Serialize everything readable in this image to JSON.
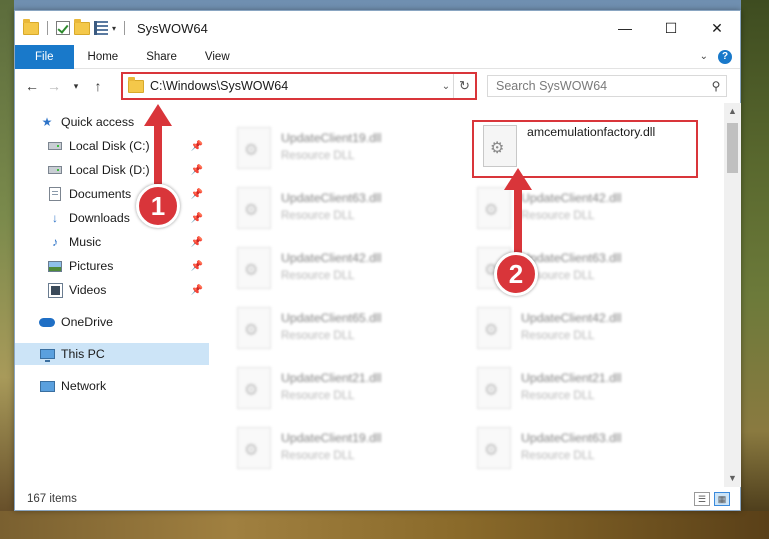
{
  "window": {
    "title": "SysWOW64",
    "controls": {
      "minimize": "—",
      "maximize": "☐",
      "close": "✕"
    }
  },
  "ribbon": {
    "tabs": [
      "File",
      "Home",
      "Share",
      "View"
    ]
  },
  "navbar": {
    "address": "C:\\Windows\\SysWOW64",
    "search_placeholder": "Search SysWOW64"
  },
  "sidebar": {
    "items": [
      {
        "label": "Quick access",
        "icon": "star-icon",
        "pinned": false
      },
      {
        "label": "Local Disk (C:)",
        "icon": "drive-icon",
        "pinned": true
      },
      {
        "label": "Local Disk (D:)",
        "icon": "drive-icon",
        "pinned": true
      },
      {
        "label": "Documents",
        "icon": "documents-icon",
        "pinned": true
      },
      {
        "label": "Downloads",
        "icon": "downloads-icon",
        "pinned": true
      },
      {
        "label": "Music",
        "icon": "music-icon",
        "pinned": true
      },
      {
        "label": "Pictures",
        "icon": "pictures-icon",
        "pinned": true
      },
      {
        "label": "Videos",
        "icon": "videos-icon",
        "pinned": true
      },
      {
        "label": "OneDrive",
        "icon": "cloud-icon",
        "pinned": false
      },
      {
        "label": "This PC",
        "icon": "pc-icon",
        "pinned": false,
        "selected": true
      },
      {
        "label": "Network",
        "icon": "network-icon",
        "pinned": false
      }
    ]
  },
  "files": [
    {
      "name": "UpdateClient19.dll",
      "type": "Resource DLL",
      "blurred": true
    },
    {
      "name": "amcemulationfactory.dll",
      "type": "",
      "blurred": false,
      "highlighted": true
    },
    {
      "name": "UpdateClient63.dll",
      "type": "Resource DLL",
      "blurred": true
    },
    {
      "name": "UpdateClient42.dll",
      "type": "Resource DLL",
      "blurred": true
    },
    {
      "name": "UpdateClient42.dll",
      "type": "Resource DLL",
      "blurred": true
    },
    {
      "name": "UpdateClient63.dll",
      "type": "Resource DLL",
      "blurred": true
    },
    {
      "name": "UpdateClient65.dll",
      "type": "Resource DLL",
      "blurred": true
    },
    {
      "name": "UpdateClient42.dll",
      "type": "Resource DLL",
      "blurred": true
    },
    {
      "name": "UpdateClient21.dll",
      "type": "Resource DLL",
      "blurred": true
    },
    {
      "name": "UpdateClient21.dll",
      "type": "Resource DLL",
      "blurred": true
    },
    {
      "name": "UpdateClient19.dll",
      "type": "Resource DLL",
      "blurred": true
    },
    {
      "name": "UpdateClient63.dll",
      "type": "Resource DLL",
      "blurred": true
    }
  ],
  "status": {
    "item_count": "167 items"
  },
  "annotations": {
    "step1": "1",
    "step2": "2",
    "color": "#d9353a"
  }
}
